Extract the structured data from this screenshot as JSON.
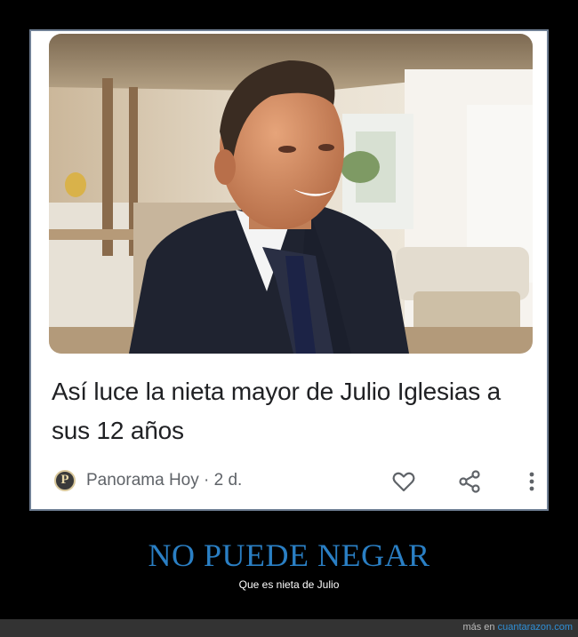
{
  "card": {
    "headline": "Así luce la nieta mayor de Julio Iglesias a sus 12 años",
    "source_logo_letter": "P",
    "source_name": "Panorama Hoy · 2 d.",
    "actions": [
      {
        "icon": "heart-icon"
      },
      {
        "icon": "share-icon"
      },
      {
        "icon": "more-vert-icon"
      }
    ]
  },
  "meme": {
    "title": "NO PUEDE NEGAR",
    "subtitle": "Que es nieta de Julio"
  },
  "footer": {
    "prefix": "más en ",
    "site": "cuantarazon.com"
  },
  "colors": {
    "background": "#000000",
    "frame_border": "#6f7f94",
    "title": "#2a7fc4",
    "footer_bar": "#333333",
    "link": "#2f8fd6"
  }
}
